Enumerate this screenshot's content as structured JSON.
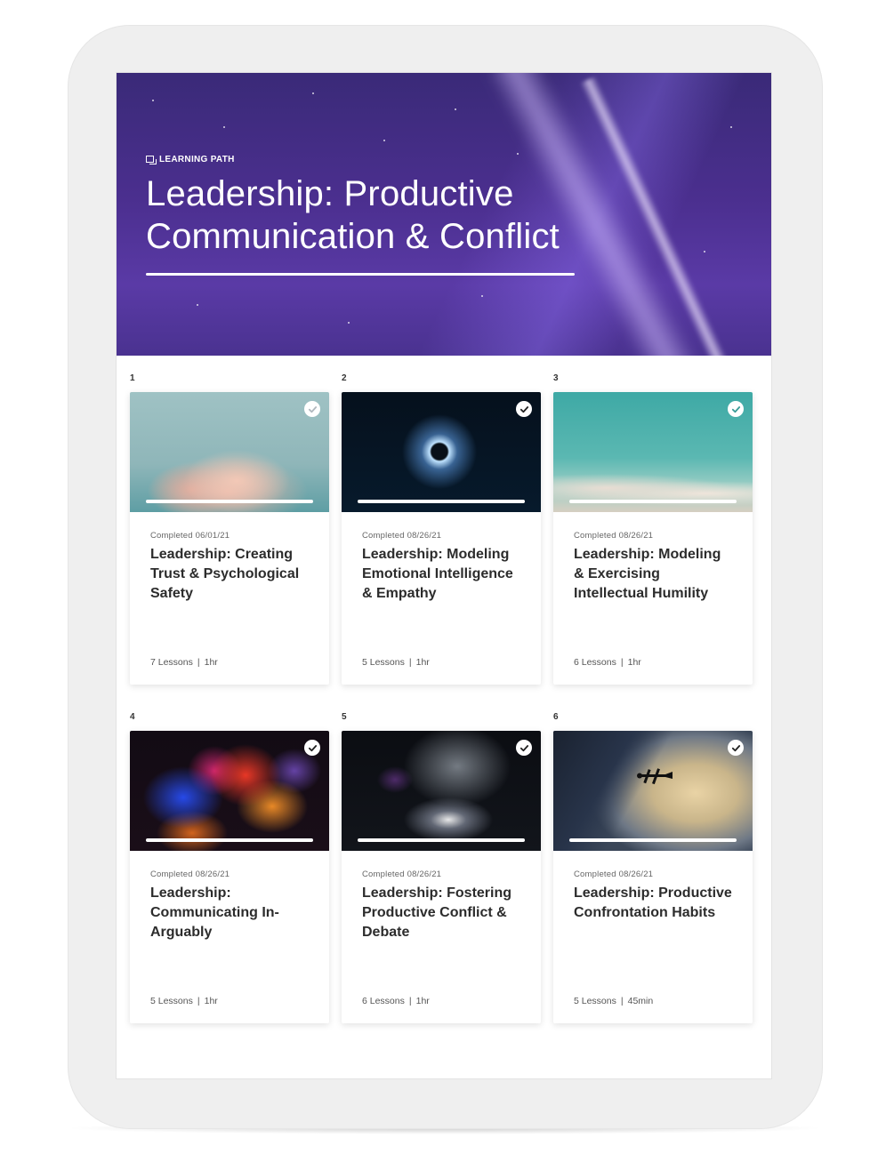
{
  "hero": {
    "eyebrow": "LEARNING PATH",
    "title": "Leadership: Productive Communication & Conflict"
  },
  "courses": [
    {
      "number": "1",
      "completed": "Completed 06/01/21",
      "title": "Leadership: Creating Trust & Psychological Safety",
      "lessons": "7 Lessons",
      "duration": "1hr",
      "progress": 1.0
    },
    {
      "number": "2",
      "completed": "Completed 08/26/21",
      "title": "Leadership: Modeling Emotional Intelligence & Empathy",
      "lessons": "5 Lessons",
      "duration": "1hr",
      "progress": 1.0
    },
    {
      "number": "3",
      "completed": "Completed 08/26/21",
      "title": "Leadership: Modeling & Exercising Intellectual Humility",
      "lessons": "6 Lessons",
      "duration": "1hr",
      "progress": 1.0
    },
    {
      "number": "4",
      "completed": "Completed 08/26/21",
      "title": "Leadership: Communicating In-Arguably",
      "lessons": "5 Lessons",
      "duration": "1hr",
      "progress": 1.0
    },
    {
      "number": "5",
      "completed": "Completed 08/26/21",
      "title": "Leadership: Fostering Productive Conflict & Debate",
      "lessons": "6 Lessons",
      "duration": "1hr",
      "progress": 1.0
    },
    {
      "number": "6",
      "completed": "Completed 08/26/21",
      "title": "Leadership: Productive Confrontation Habits",
      "lessons": "5 Lessons",
      "duration": "45min",
      "progress": 1.0
    }
  ],
  "meta_separator": "|",
  "icons": {
    "eyebrow": "learning-path-icon",
    "status": "check-circle-icon"
  },
  "colors": {
    "hero_purple": "#4b2f8f",
    "title_text": "#2c2c2c",
    "muted_text": "#666666"
  }
}
